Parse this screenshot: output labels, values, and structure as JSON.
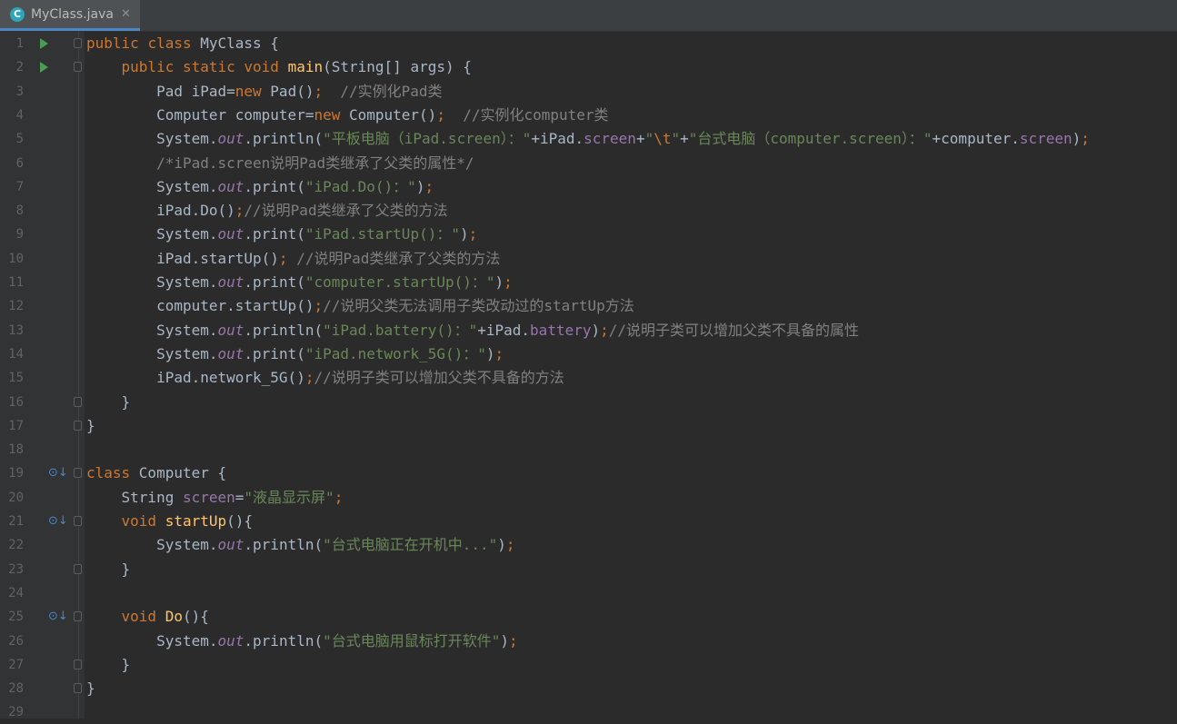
{
  "tab": {
    "title": "MyClass.java",
    "icon": "class-icon"
  },
  "lines": [
    {
      "n": "1",
      "gutter": "run",
      "fold": true,
      "tokens": [
        [
          "kw",
          "public "
        ],
        [
          "kw",
          "class "
        ],
        [
          "cls",
          "MyClass "
        ],
        [
          "cls",
          "{"
        ]
      ]
    },
    {
      "n": "2",
      "gutter": "run",
      "fold": true,
      "tokens": [
        [
          "cls",
          "    "
        ],
        [
          "kw",
          "public "
        ],
        [
          "kw",
          "static "
        ],
        [
          "kw",
          "void "
        ],
        [
          "fn",
          "main"
        ],
        [
          "cls",
          "(String[] args) {"
        ]
      ]
    },
    {
      "n": "3",
      "gutter": "",
      "fold": false,
      "tokens": [
        [
          "cls",
          "        Pad iPad="
        ],
        [
          "kw",
          "new "
        ],
        [
          "cls",
          "Pad()"
        ],
        [
          "punct",
          ";"
        ],
        [
          "cls",
          "  "
        ],
        [
          "cmt",
          "//实例化Pad类"
        ]
      ]
    },
    {
      "n": "4",
      "gutter": "",
      "fold": false,
      "tokens": [
        [
          "cls",
          "        Computer computer="
        ],
        [
          "kw",
          "new "
        ],
        [
          "cls",
          "Computer()"
        ],
        [
          "punct",
          ";"
        ],
        [
          "cls",
          "  "
        ],
        [
          "cmt",
          "//实例化computer类"
        ]
      ]
    },
    {
      "n": "5",
      "gutter": "",
      "fold": false,
      "tokens": [
        [
          "cls",
          "        System."
        ],
        [
          "st",
          "out"
        ],
        [
          "cls",
          ".println("
        ],
        [
          "str",
          "\"平板电脑（iPad.screen）：\""
        ],
        [
          "cls",
          "+iPad."
        ],
        [
          "fld",
          "screen"
        ],
        [
          "cls",
          "+"
        ],
        [
          "str",
          "\""
        ],
        [
          "esc",
          "\\t"
        ],
        [
          "str",
          "\""
        ],
        [
          "cls",
          "+"
        ],
        [
          "str",
          "\"台式电脑（computer.screen）：\""
        ],
        [
          "cls",
          "+computer."
        ],
        [
          "fld",
          "screen"
        ],
        [
          "cls",
          ")"
        ],
        [
          "punct",
          ";"
        ]
      ]
    },
    {
      "n": "6",
      "gutter": "",
      "fold": false,
      "tokens": [
        [
          "cls",
          "        "
        ],
        [
          "cmt",
          "/*iPad.screen说明Pad类继承了父类的属性*/"
        ]
      ]
    },
    {
      "n": "7",
      "gutter": "",
      "fold": false,
      "tokens": [
        [
          "cls",
          "        System."
        ],
        [
          "st",
          "out"
        ],
        [
          "cls",
          ".print("
        ],
        [
          "str",
          "\"iPad.Do()：\""
        ],
        [
          "cls",
          ")"
        ],
        [
          "punct",
          ";"
        ]
      ]
    },
    {
      "n": "8",
      "gutter": "",
      "fold": false,
      "tokens": [
        [
          "cls",
          "        iPad.Do()"
        ],
        [
          "punct",
          ";"
        ],
        [
          "cmt",
          "//说明Pad类继承了父类的方法"
        ]
      ]
    },
    {
      "n": "9",
      "gutter": "",
      "fold": false,
      "tokens": [
        [
          "cls",
          "        System."
        ],
        [
          "st",
          "out"
        ],
        [
          "cls",
          ".print("
        ],
        [
          "str",
          "\"iPad.startUp()：\""
        ],
        [
          "cls",
          ")"
        ],
        [
          "punct",
          ";"
        ]
      ]
    },
    {
      "n": "10",
      "gutter": "",
      "fold": false,
      "tokens": [
        [
          "cls",
          "        iPad.startUp()"
        ],
        [
          "punct",
          ";"
        ],
        [
          "cls",
          " "
        ],
        [
          "cmt",
          "//说明Pad类继承了父类的方法"
        ]
      ]
    },
    {
      "n": "11",
      "gutter": "",
      "fold": false,
      "tokens": [
        [
          "cls",
          "        System."
        ],
        [
          "st",
          "out"
        ],
        [
          "cls",
          ".print("
        ],
        [
          "str",
          "\"computer.startUp()：\""
        ],
        [
          "cls",
          ")"
        ],
        [
          "punct",
          ";"
        ]
      ]
    },
    {
      "n": "12",
      "gutter": "",
      "fold": false,
      "tokens": [
        [
          "cls",
          "        computer.startUp()"
        ],
        [
          "punct",
          ";"
        ],
        [
          "cmt",
          "//说明父类无法调用子类改动过的startUp方法"
        ]
      ]
    },
    {
      "n": "13",
      "gutter": "",
      "fold": false,
      "tokens": [
        [
          "cls",
          "        System."
        ],
        [
          "st",
          "out"
        ],
        [
          "cls",
          ".println("
        ],
        [
          "str",
          "\"iPad.battery()：\""
        ],
        [
          "cls",
          "+iPad."
        ],
        [
          "fld",
          "battery"
        ],
        [
          "cls",
          ")"
        ],
        [
          "punct",
          ";"
        ],
        [
          "cmt",
          "//说明子类可以增加父类不具备的属性"
        ]
      ]
    },
    {
      "n": "14",
      "gutter": "",
      "fold": false,
      "tokens": [
        [
          "cls",
          "        System."
        ],
        [
          "st",
          "out"
        ],
        [
          "cls",
          ".print("
        ],
        [
          "str",
          "\"iPad.network_5G()：\""
        ],
        [
          "cls",
          ")"
        ],
        [
          "punct",
          ";"
        ]
      ]
    },
    {
      "n": "15",
      "gutter": "",
      "fold": false,
      "tokens": [
        [
          "cls",
          "        iPad.network_5G()"
        ],
        [
          "punct",
          ";"
        ],
        [
          "cmt",
          "//说明子类可以增加父类不具备的方法"
        ]
      ]
    },
    {
      "n": "16",
      "gutter": "",
      "fold": true,
      "tokens": [
        [
          "cls",
          "    }"
        ]
      ]
    },
    {
      "n": "17",
      "gutter": "",
      "fold": true,
      "tokens": [
        [
          "cls",
          "}"
        ]
      ]
    },
    {
      "n": "18",
      "gutter": "",
      "fold": false,
      "tokens": []
    },
    {
      "n": "19",
      "gutter": "override",
      "fold": true,
      "tokens": [
        [
          "kw",
          "class "
        ],
        [
          "cls",
          "Computer {"
        ]
      ]
    },
    {
      "n": "20",
      "gutter": "",
      "fold": false,
      "tokens": [
        [
          "cls",
          "    String "
        ],
        [
          "fld",
          "screen"
        ],
        [
          "cls",
          "="
        ],
        [
          "str",
          "\"液晶显示屏\""
        ],
        [
          "punct",
          ";"
        ]
      ]
    },
    {
      "n": "21",
      "gutter": "override",
      "fold": true,
      "tokens": [
        [
          "cls",
          "    "
        ],
        [
          "kw",
          "void "
        ],
        [
          "fn",
          "startUp"
        ],
        [
          "cls",
          "(){"
        ]
      ]
    },
    {
      "n": "22",
      "gutter": "",
      "fold": false,
      "tokens": [
        [
          "cls",
          "        System."
        ],
        [
          "st",
          "out"
        ],
        [
          "cls",
          ".println("
        ],
        [
          "str",
          "\"台式电脑正在开机中...\""
        ],
        [
          "cls",
          ")"
        ],
        [
          "punct",
          ";"
        ]
      ]
    },
    {
      "n": "23",
      "gutter": "",
      "fold": true,
      "tokens": [
        [
          "cls",
          "    }"
        ]
      ]
    },
    {
      "n": "24",
      "gutter": "",
      "fold": false,
      "tokens": []
    },
    {
      "n": "25",
      "gutter": "override",
      "fold": true,
      "tokens": [
        [
          "cls",
          "    "
        ],
        [
          "kw",
          "void "
        ],
        [
          "fn",
          "Do"
        ],
        [
          "cls",
          "(){"
        ]
      ]
    },
    {
      "n": "26",
      "gutter": "",
      "fold": false,
      "tokens": [
        [
          "cls",
          "        System."
        ],
        [
          "st",
          "out"
        ],
        [
          "cls",
          ".println("
        ],
        [
          "str",
          "\"台式电脑用鼠标打开软件\""
        ],
        [
          "cls",
          ")"
        ],
        [
          "punct",
          ";"
        ]
      ]
    },
    {
      "n": "27",
      "gutter": "",
      "fold": true,
      "tokens": [
        [
          "cls",
          "    }"
        ]
      ]
    },
    {
      "n": "28",
      "gutter": "",
      "fold": true,
      "tokens": [
        [
          "cls",
          "}"
        ]
      ]
    },
    {
      "n": "29",
      "gutter": "",
      "fold": false,
      "tokens": []
    }
  ],
  "colors": {
    "background": "#2b2b2b",
    "gutter": "#313335",
    "keyword": "#cc7832",
    "string": "#6a8759",
    "comment": "#808080",
    "method": "#ffc66d",
    "field": "#9876aa"
  }
}
